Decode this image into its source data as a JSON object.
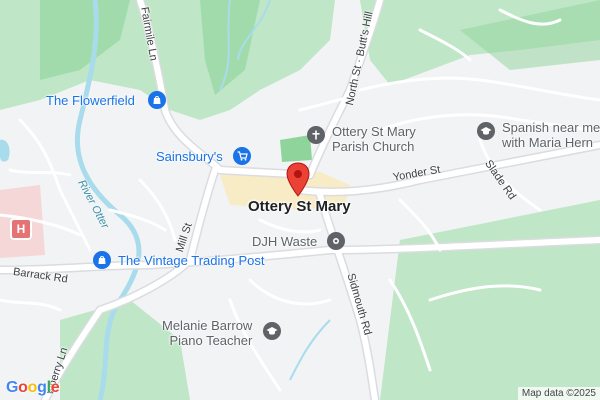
{
  "map": {
    "town": "Ottery St Mary",
    "colors": {
      "background": "#f1f3f4",
      "park": "#bfe6c6",
      "park_dark": "#8fd49a",
      "road": "#ffffff",
      "road_outline": "#dadce0",
      "river": "#a8dcec",
      "town_centre": "#f8ecc6",
      "marker": "#ea4335",
      "poi_blue": "#1a73e8",
      "poi_grey": "#5f6368",
      "hospital": "#e57373"
    },
    "places": [
      {
        "id": "flowerfield",
        "name": "The Flowerfield",
        "icon": "shopping-bag-icon"
      },
      {
        "id": "sainsburys",
        "name": "Sainsbury's",
        "icon": "shopping-cart-icon"
      },
      {
        "id": "vintage",
        "name": "The Vintage Trading Post",
        "icon": "shopping-bag-icon"
      },
      {
        "id": "church",
        "name": "Ottery St Mary Parish Church",
        "name_line1": "Ottery St Mary",
        "name_line2": "Parish Church",
        "icon": "church-cross-icon"
      },
      {
        "id": "spanish",
        "name_line1": "Spanish near me",
        "name_line2": "with Maria Hern",
        "icon": "school-icon"
      },
      {
        "id": "djh",
        "name": "DJH Waste",
        "icon": "place-dot-icon"
      },
      {
        "id": "melanie",
        "name_line1": "Melanie Barrow",
        "name_line2": "Piano Teacher",
        "icon": "school-icon"
      }
    ],
    "roads": {
      "fairmile_ln": "Fairmile Ln",
      "north_st": "North St · Butt's Hill",
      "yonder_st": "Yonder St",
      "slade_rd": "Slade Rd",
      "mill_st": "Mill St",
      "barrack_rd": "Barrack Rd",
      "sidmouth_rd": "Sidmouth Rd",
      "strawberry_ln": "wberry Ln"
    },
    "river": "River Otter",
    "hospital_icon": "hospital-icon",
    "marker_icon": "location-pin-icon",
    "attribution": "Map data ©2025",
    "logo": "Google"
  }
}
